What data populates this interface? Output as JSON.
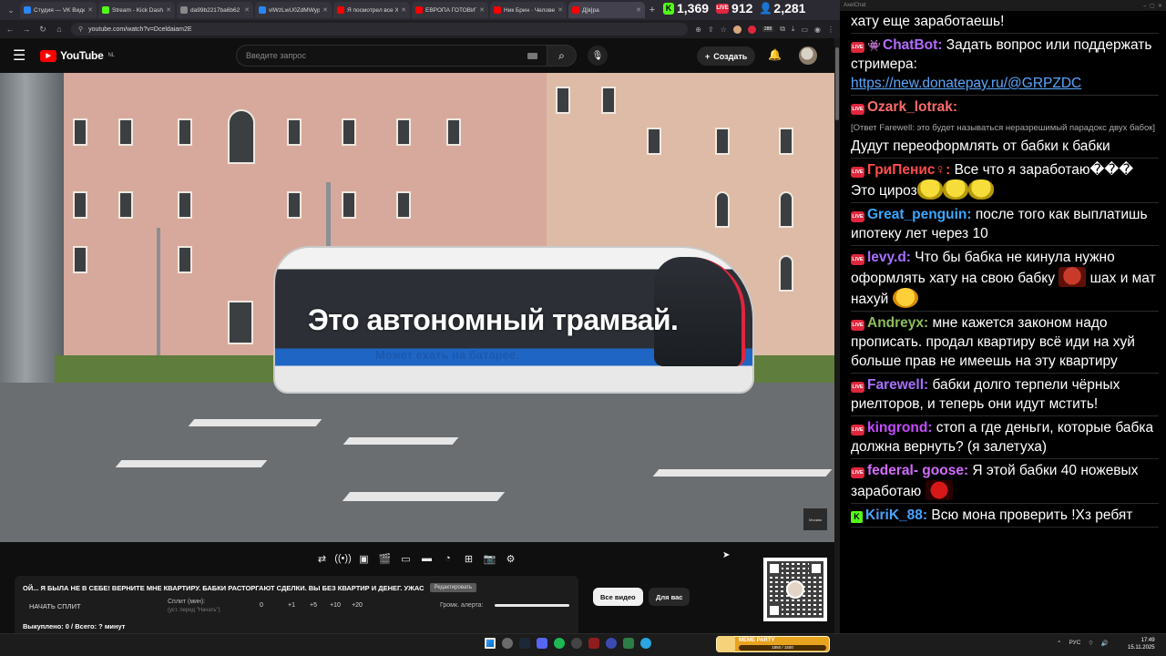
{
  "browser": {
    "tabs": [
      {
        "title": "Студия — VK Видео",
        "color": "#2787f5"
      },
      {
        "title": "Stream - Kick Dashb",
        "color": "#53fc18"
      },
      {
        "title": "da99b2217ba6b62",
        "color": "#888888"
      },
      {
        "title": "vlWzLwU0ZdMWyp",
        "color": "#2787f5"
      },
      {
        "title": "Я посмотрел все Х",
        "color": "#ff0000"
      },
      {
        "title": "ЕВРОПА ГОТОВИТ",
        "color": "#ff0000"
      },
      {
        "title": "Ник Брин · Челове",
        "color": "#ff0000"
      },
      {
        "title": "Д[в]ра",
        "color": "#ff0000"
      }
    ],
    "url": "youtube.com/watch?v=Dceldaiam2E",
    "ext_badge": "288"
  },
  "stats": {
    "kick_viewers": "1,369",
    "live_viewers": "912",
    "total_viewers": "2,281",
    "kick_badge": "K",
    "live_badge": "LIVE"
  },
  "youtube": {
    "logo_text": "YouTube",
    "region": "NL",
    "search_placeholder": "Введите запрос",
    "create_label": "Создать"
  },
  "video": {
    "caption": "Это автономный трамвай.",
    "subcaption": "Может ехать на батарее.",
    "watermark": "Москва"
  },
  "panel": {
    "title": "ОЙ... Я БЫЛА НЕ В СЕБЕ! ВЕРНИТЕ МНЕ КВАРТИРУ. БАБКИ РАСТОРГАЮТ СДЕЛКИ. ВЫ БЕЗ КВАРТИР И ДЕНЕГ. УЖАС",
    "edit_label": "Редактировать",
    "start_split": "НАЧАТЬ СПЛИТ",
    "split_label": "Сплит (мин):",
    "split_hint": "(уст. перед \"Начать\")",
    "split_values": [
      "0",
      "+1",
      "+5",
      "+10",
      "+20"
    ],
    "alert_volume_label": "Громк. алерта:",
    "bought": "Выкуплено: 0 / Всего: ? минут"
  },
  "chips": {
    "all": "Все видео",
    "for_you": "Для вас"
  },
  "chat": {
    "window_title": "AxelChat",
    "messages": [
      {
        "platform": "none",
        "nick": "",
        "nick_color": "#ffffff",
        "text": "хату еще заработаешь!"
      },
      {
        "platform": "live",
        "nick": "ChatBot:",
        "nick_color": "#b46cff",
        "text": "Задать вопрос или поддержать стримера:",
        "link": "https://new.donatepay.ru/@GRPZDC"
      },
      {
        "platform": "live",
        "nick": "Ozark_lotrak:",
        "nick_color": "#ff6b6b",
        "reply": "[Ответ Farewell: это будет называться неразрешимый парадокс двух бабок]",
        "text": "Дудут переоформлять от бабки к бабки"
      },
      {
        "platform": "live",
        "nick": "ГриПенис♀:",
        "nick_color": "#ff4d4d",
        "text": "Все что я заработаю��� Это цироз",
        "emotes": [
          "yellow",
          "yellow",
          "yellow"
        ]
      },
      {
        "platform": "live",
        "nick": "Great_penguin:",
        "nick_color": "#3ba7ff",
        "text": "после того как выплатишь ипотеку лет через 10"
      },
      {
        "platform": "live",
        "nick": "levy.d:",
        "nick_color": "#a770ff",
        "text": "Что бы бабка не кинула нужно оформлять хату на свою бабку",
        "after_emote": "red",
        "text2": "шах и мат нахуй",
        "end_emote": "laugh"
      },
      {
        "platform": "live",
        "nick": "Andreyx:",
        "nick_color": "#8fbc5a",
        "text": "мне кажется законом надо прописать. продал квартиру всё иди на хуй больше прав не имеешь на эту квартиру"
      },
      {
        "platform": "live",
        "nick": "Farewell:",
        "nick_color": "#a770ff",
        "text": "бабки долго терпели чёрных риелторов, и теперь они идут мстить!"
      },
      {
        "platform": "live",
        "nick": "kingrond:",
        "nick_color": "#c64bff",
        "text": "стоп а где деньги, которые бабка должна вернуть? (я залетуха)"
      },
      {
        "platform": "live",
        "nick": "federal- goose:",
        "nick_color": "#d36cff",
        "text": "Я этой бабки 40 ножевых заработаю",
        "end_emote": "devil"
      },
      {
        "platform": "kick",
        "nick": "KiriK_88:",
        "nick_color": "#4aa3ff",
        "text": "Всю мона проверить !Хз ребят"
      }
    ]
  },
  "taskbar": {
    "meme_title": "MEME PARTY",
    "meme_progress_text": "1850 / 1500",
    "lang": "РУС",
    "time": "17:49",
    "date": "15.11.2025"
  }
}
